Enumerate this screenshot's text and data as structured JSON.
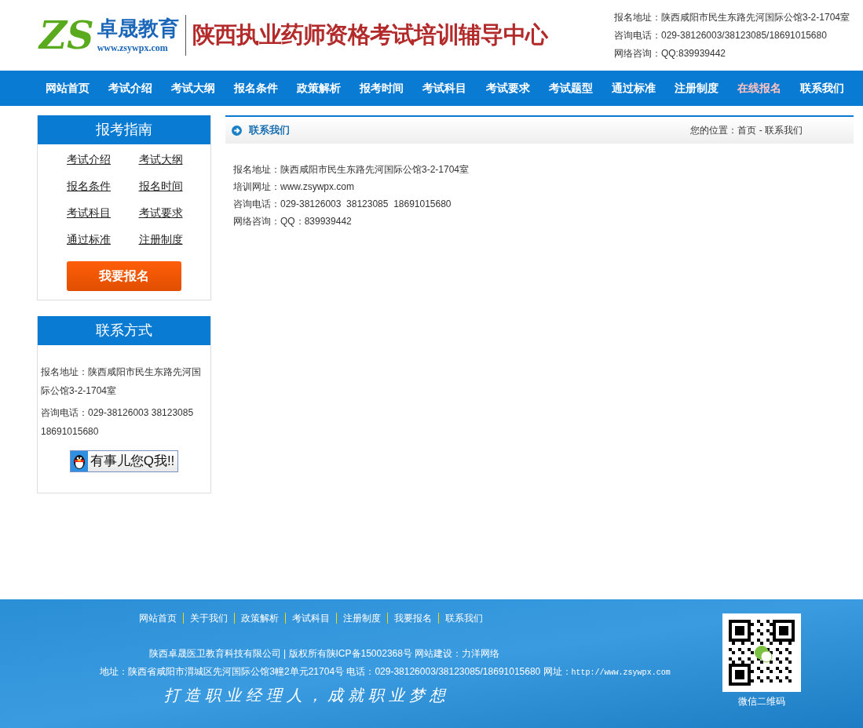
{
  "header": {
    "logo_mark": "ZS",
    "logo_name": "卓晟教育",
    "logo_url": "www.zsywpx.com",
    "site_title": "陕西执业药师资格考试培训辅导中心",
    "contact_lines": [
      "报名地址：陕西咸阳市民生东路先河国际公馆3-2-1704室",
      "咨询电话：029-38126003/38123085/18691015680",
      "网络咨询：QQ:839939442"
    ]
  },
  "nav": [
    {
      "label": "网站首页",
      "highlight": false
    },
    {
      "label": "考试介绍",
      "highlight": false
    },
    {
      "label": "考试大纲",
      "highlight": false
    },
    {
      "label": "报名条件",
      "highlight": false
    },
    {
      "label": "政策解析",
      "highlight": false
    },
    {
      "label": "报考时间",
      "highlight": false
    },
    {
      "label": "考试科目",
      "highlight": false
    },
    {
      "label": "考试要求",
      "highlight": false
    },
    {
      "label": "考试题型",
      "highlight": false
    },
    {
      "label": "通过标准",
      "highlight": false
    },
    {
      "label": "注册制度",
      "highlight": false
    },
    {
      "label": "在线报名",
      "highlight": true
    },
    {
      "label": "联系我们",
      "highlight": false
    }
  ],
  "guide": {
    "title": "报考指南",
    "links": [
      "考试介绍",
      "考试大纲",
      "报名条件",
      "报名时间",
      "考试科目",
      "考试要求",
      "通过标准",
      "注册制度"
    ],
    "button": "我要报名"
  },
  "contact_box": {
    "title": "联系方式",
    "lines": [
      "报名地址：陕西咸阳市民生东路先河国际公馆3-2-1704室",
      "咨询电话：029-38126003 38123085 18691015680"
    ],
    "qq_button": "有事儿您Q我!!"
  },
  "content": {
    "title": "联系我们",
    "breadcrumb": "您的位置：首页 - 联系我们",
    "lines": [
      "报名地址：陕西咸阳市民生东路先河国际公馆3-2-1704室",
      "培训网址：www.zsywpx.com",
      "咨询电话：029-38126003  38123085  18691015680",
      "网络咨询：QQ：839939442"
    ]
  },
  "footer": {
    "links": [
      "网站首页",
      "关于我们",
      "政策解析",
      "考试科目",
      "注册制度",
      "我要报名",
      "联系我们"
    ],
    "company_line": "陕西卓晟医卫教育科技有限公司 | 版权所有陕ICP备15002368号 网站建设：力洋网络",
    "address_line": "地址：陕西省咸阳市渭城区先河国际公馆3幢2单元21704号 电话：029-38126003/38123085/18691015680 网址：",
    "url": "http://www.zsywpx.com",
    "slogan": "打造职业经理人，成就职业梦想",
    "qr_caption": "微信二维码"
  }
}
